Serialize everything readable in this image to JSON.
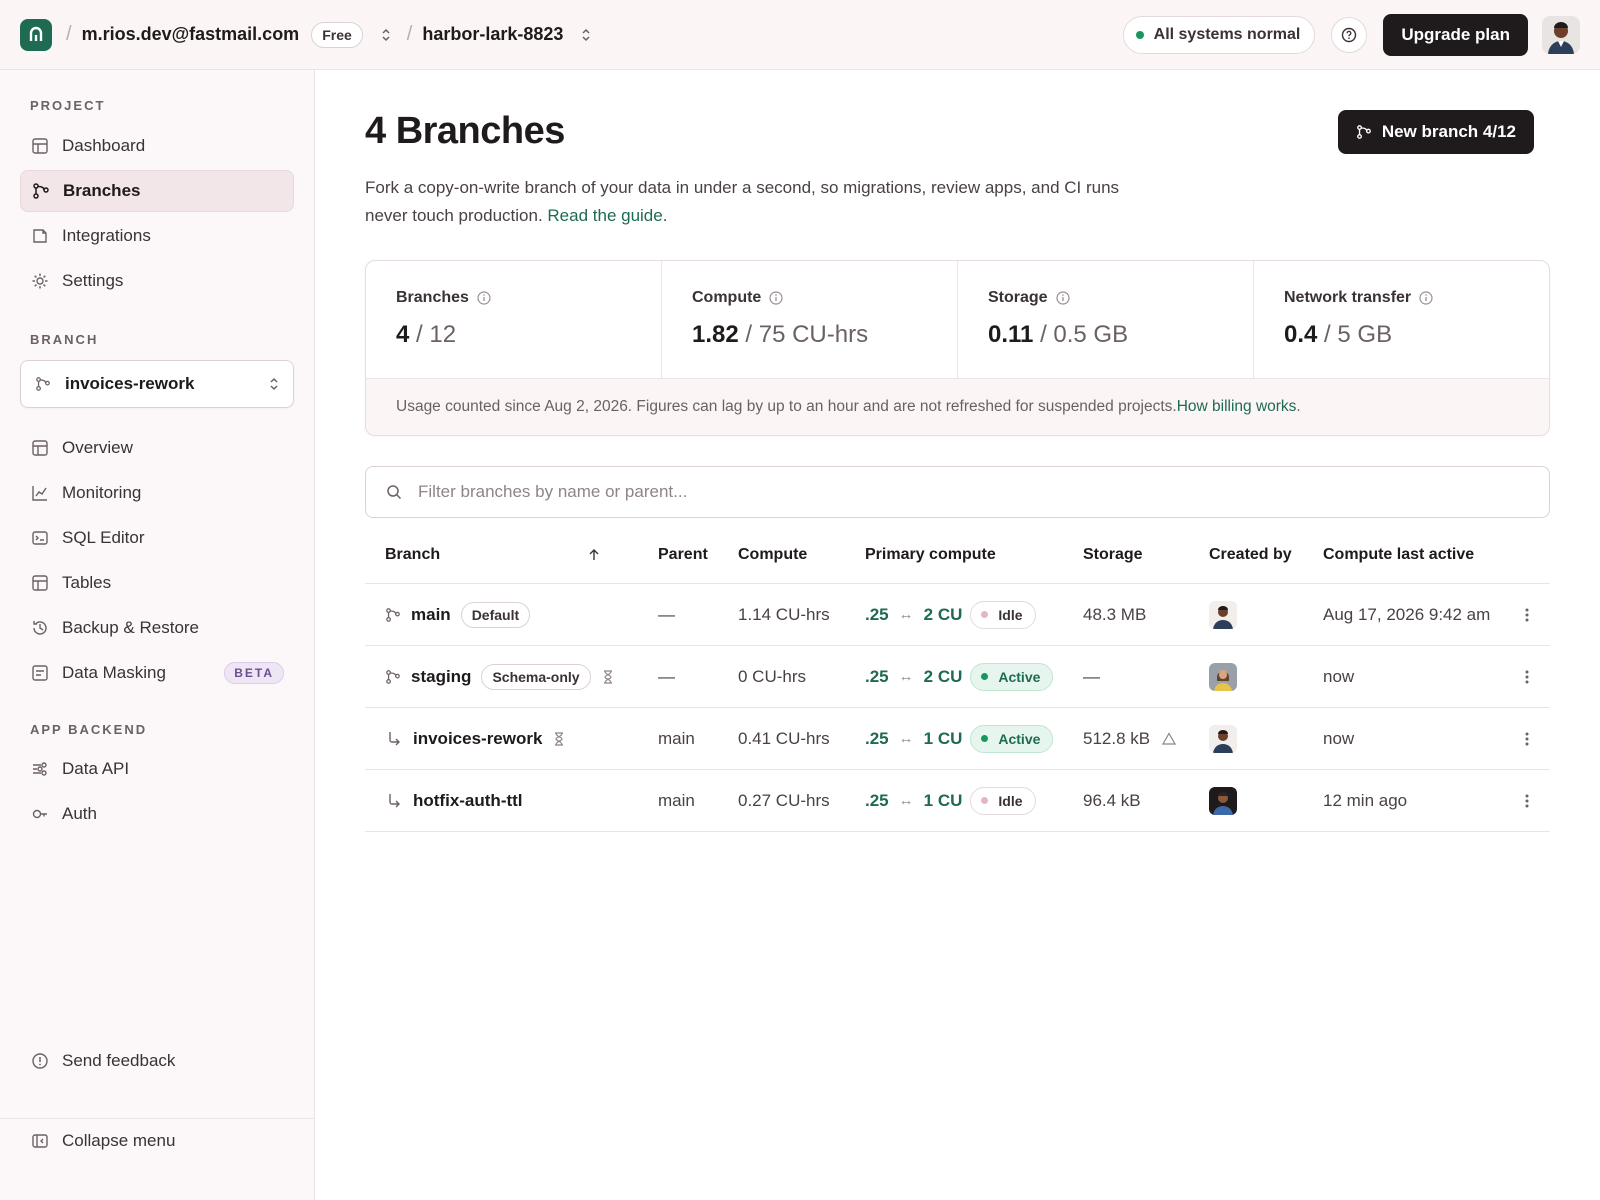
{
  "topbar": {
    "account_email": "m.rios.dev@fastmail.com",
    "plan": "Free",
    "project": "harbor-lark-8823",
    "status": "All systems normal",
    "upgrade_label": "Upgrade plan",
    "status_color": "#17965f"
  },
  "sidebar": {
    "project_label": "PROJECT",
    "project_items": [
      {
        "label": "Dashboard",
        "icon": "dashboard-icon"
      },
      {
        "label": "Branches",
        "icon": "branch-icon",
        "active": true
      },
      {
        "label": "Integrations",
        "icon": "integrations-icon"
      },
      {
        "label": "Settings",
        "icon": "gear-icon"
      }
    ],
    "branch_label": "BRANCH",
    "current_branch": "invoices-rework",
    "branch_items": [
      {
        "label": "Overview",
        "icon": "overview-icon"
      },
      {
        "label": "Monitoring",
        "icon": "chart-icon"
      },
      {
        "label": "SQL Editor",
        "icon": "terminal-icon"
      },
      {
        "label": "Tables",
        "icon": "table-icon"
      },
      {
        "label": "Backup & Restore",
        "icon": "history-icon"
      },
      {
        "label": "Data Masking",
        "icon": "mask-icon",
        "badge": "BETA"
      }
    ],
    "backend_label": "APP BACKEND",
    "backend_items": [
      {
        "label": "Data API",
        "icon": "api-icon"
      },
      {
        "label": "Auth",
        "icon": "key-icon"
      }
    ],
    "feedback_label": "Send feedback",
    "collapse_label": "Collapse menu"
  },
  "main": {
    "title": "4 Branches",
    "new_branch_label": "New branch 4/12",
    "description": "Fork a copy-on-write branch of your data in under a second, so migrations, review apps, and CI runs never touch production. ",
    "guide_link": "Read the guide",
    "usage": [
      {
        "label": "Branches",
        "used": "4",
        "limit": "/ 12"
      },
      {
        "label": "Compute",
        "used": "1.82",
        "limit": "/ 75 CU-hrs"
      },
      {
        "label": "Storage",
        "used": "0.11",
        "limit": "/ 0.5 GB"
      },
      {
        "label": "Network transfer",
        "used": "0.4",
        "limit": "/ 5 GB"
      }
    ],
    "usage_note": "Usage counted since Aug 2, 2026. Figures can lag by up to an hour and are not refreshed for suspended projects. ",
    "billing_link": "How billing works",
    "filter_placeholder": "Filter branches by name or parent...",
    "columns": [
      "Branch",
      "Parent",
      "Compute",
      "Primary compute",
      "Storage",
      "Created by",
      "Compute last active"
    ],
    "rows": [
      {
        "name": "main",
        "tag": "Default",
        "parent": "—",
        "compute": "1.14 CU-hrs",
        "min_cu": ".25",
        "max_cu": "2 CU",
        "state": "Idle",
        "storage": "48.3 MB",
        "last_active": "Aug 17, 2026 9:42 am"
      },
      {
        "name": "staging",
        "tag": "Schema-only",
        "parent": "—",
        "compute": "0 CU-hrs",
        "min_cu": ".25",
        "max_cu": "2 CU",
        "state": "Active",
        "storage": "—",
        "last_active": "now"
      },
      {
        "name": "invoices-rework",
        "tag": "",
        "parent": "main",
        "compute": "0.41 CU-hrs",
        "min_cu": ".25",
        "max_cu": "1 CU",
        "state": "Active",
        "storage": "512.8 kB",
        "last_active": "now"
      },
      {
        "name": "hotfix-auth-ttl",
        "tag": "",
        "parent": "main",
        "compute": "0.27 CU-hrs",
        "min_cu": ".25",
        "max_cu": "1 CU",
        "state": "Idle",
        "storage": "96.4 kB",
        "last_active": "12 min ago"
      }
    ],
    "accent_color": "#1e6a53"
  }
}
